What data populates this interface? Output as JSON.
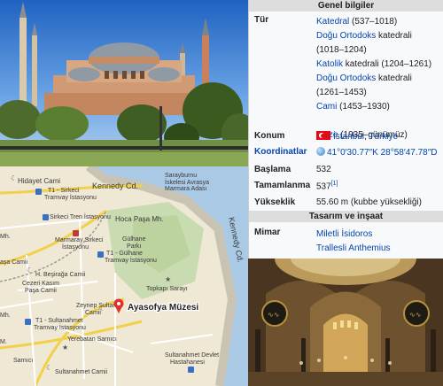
{
  "infobox": {
    "header_general": "Genel bilgiler",
    "header_design": "Tasarım ve inşaat",
    "type_label": "Tür",
    "type_lines": [
      {
        "link": "Katedral",
        "text": " (537–1018)"
      },
      {
        "link": "Doğu Ortodoks",
        "text": " katedrali"
      },
      {
        "link": "",
        "text": "(1018–1204)"
      },
      {
        "link": "Katolik",
        "text": " katedrali (1204–1261)"
      },
      {
        "link": "Doğu Ortodoks",
        "text": " katedrali"
      },
      {
        "link": "",
        "text": "(1261–1453)"
      },
      {
        "link": "Cami",
        "text": " (1453–1930)"
      },
      {
        "link": "",
        "text": ""
      },
      {
        "link": "Müze",
        "text": " (1935–günümüz)"
      }
    ],
    "location_label": "Konum",
    "location_city": "İstanbul",
    "location_sep": ", ",
    "location_country": "Türkiye",
    "coords_label": "Koordinatlar",
    "coords_value": "41°0′30.77″K 28°58′47.78″D",
    "start_label": "Başlama",
    "start_value": "532",
    "end_label": "Tamamlanma",
    "end_value": "537",
    "end_ref": "[1]",
    "height_label": "Yükseklik",
    "height_value": "55.60 m (kubbe yüksekliği)",
    "architect_label": "Mimar",
    "architect_1": "Miletli İsidoros",
    "architect_2": "Trallesli Anthemius"
  },
  "map": {
    "poi_label": "Ayasofya Müzesi",
    "labels": {
      "hidayet": "Hidayet Cami",
      "kennedy": "Kennedy Cd.",
      "kennedy_v": "Kennedy Cd.",
      "sarayburnu": "Sarayburnu",
      "iskelesi": "İskelesi Avrasya",
      "marmara": "Marmara Adası",
      "t1sirkeci": "T1 - Sirkeci",
      "tramvay1": "Tramvay İstasyonu",
      "sirkeci_tren": "Sirkeci Tren İstasyonu",
      "hocapasa": "Hoca Paşa Mh.",
      "marmaray": "Marmaray Sirkeci",
      "marmaray2": "İstasyonu",
      "gulhane": "Gülhane",
      "gulhane2": "Parkı",
      "mh": "Mh.",
      "t1gulhane": "T1 - Gülhane",
      "tramvay2": "Tramvay İstasyonu",
      "pasa": "aşa Camii",
      "hbesir": "H. Beşirağa Camii",
      "cezeri": "Cezeri Kasım",
      "pasa_camii": "Paşa Camii",
      "topkapi": "Topkapı Sarayı",
      "zeynep": "Zeynep Sultan",
      "camii": "Camii",
      "t1sultan": "T1 - Sultanahmet",
      "tramvay3": "Tramvay İstasyonu",
      "yerebatan": "Yerebatan Sarnıcı",
      "sarnici": "Sarnıcı",
      "mh2": "Mh.",
      "m": "M.",
      "sultanahmet_camii": "Sultanahmet Camii",
      "sultanahmet_hast": "Sultanahmet Devlet",
      "hastahanesi": "Hastahanesi"
    }
  },
  "colors": {
    "link": "#0645ad",
    "header_bg": "#dddddd",
    "infobox_bg": "#f8f9fa",
    "pin": "#e0312d"
  }
}
